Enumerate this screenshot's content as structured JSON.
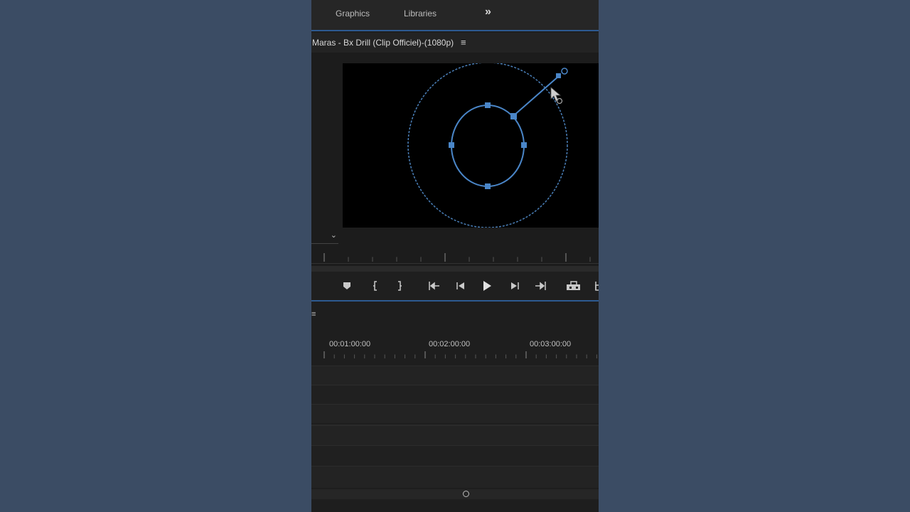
{
  "workspace_tabs": [
    "Graphics",
    "Libraries"
  ],
  "more_label": "»",
  "monitor": {
    "sequence_title": "Maras - Bx Drill (Clip Officiel)-(1080p)",
    "menu_glyph": "≡",
    "zoom_chevron": "⌄"
  },
  "transport": {
    "icons": [
      "marker-icon",
      "mark-in-icon",
      "mark-out-icon",
      "go-to-in-icon",
      "step-back-icon",
      "play-icon",
      "step-forward-icon",
      "go-to-out-icon",
      "export-frame-icon",
      "more-controls-icon"
    ]
  },
  "timeline": {
    "menu_glyph": "≡",
    "timecodes": [
      "00:01:00:00",
      "00:02:00:00",
      "00:03:00:00"
    ]
  },
  "colors": {
    "accent": "#2d5a91",
    "mask": "#4a86c8"
  }
}
